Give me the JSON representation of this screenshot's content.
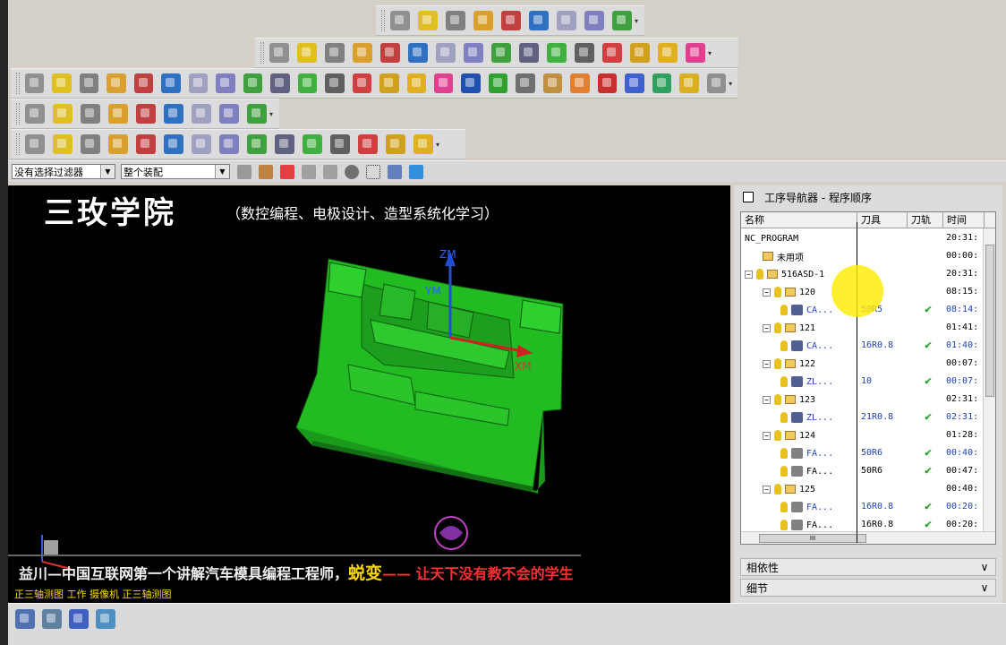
{
  "toolbars": {
    "row1": [
      "align-icon",
      "route-icon",
      "hand-icon",
      "stack-icon",
      "hand-up-icon",
      "grid-icon",
      "tree-icon",
      "list-icon",
      "clock-icon"
    ],
    "row2": [
      "check-icon",
      "ops-icon",
      "program-icon",
      "table-icon",
      "flag-icon",
      "verify-icon",
      "clipboard-icon",
      "doc-icon",
      "sparkle-icon",
      "tool-clock-icon",
      "export-icon",
      "postprocess-icon",
      "shop-doc-icon",
      "batch-icon",
      "output-icon",
      "cube-green-icon"
    ],
    "row3": [
      "box-orange-icon",
      "box-red-icon",
      "box-yellow-icon",
      "wrench-box-icon",
      "truss-icon",
      "plane-icon",
      "swap-x-icon",
      "circle-cube-icon",
      "wire-cube-icon",
      "rainbow-icon",
      "cylinder-icon",
      "tilt-box-icon",
      "ruler-icon",
      "kg-icon",
      "pipe-icon",
      "lego-icon",
      "prt-icon",
      "layers-icon",
      "stack-grey-icon",
      "cubes-icon",
      "star-icon",
      "coins-icon",
      "tube-icon",
      "hex-icon",
      "bar-green-icon",
      "bar-green2-icon"
    ],
    "row4": [
      "dxf-icon",
      "inch-mm-icon",
      "layers-blue-icon",
      "folder-icon",
      "monitor-icon",
      "note-icon",
      "calculator-icon",
      "moon-icon",
      "matrix-icon"
    ],
    "row5": [
      "layer-a-icon",
      "layer-b-icon",
      "layer-c-icon",
      "cross-icon",
      "layer-d-icon",
      "snap-icon",
      "plus-icon",
      "up-arrow-icon",
      "down-arrow-icon",
      "arrow-sheet-icon",
      "sheet-b-icon",
      "sheet-c-icon",
      "sheet-d-icon",
      "sheet-e-icon",
      "sheet-f-icon"
    ]
  },
  "filterbar": {
    "filter_label": "没有选择过滤器",
    "assembly_label": "整个装配"
  },
  "viewport": {
    "title": "三玫学院",
    "subtitle": "（数控编程、电极设计、造型系统化学习）",
    "bottom_text_1": "益川—中国互联网第一个讲解汽车模具编程工程师，",
    "bottom_text_highlight": "蜕变",
    "bottom_text_2": "—— 让天下没有教不会的学生",
    "view_label": "正三轴测图 工作 摄像机 正三轴测图",
    "axis_zm": "ZM",
    "axis_ym": "YM",
    "axis_xm": "XM",
    "part_color": "#22bb22"
  },
  "navigator": {
    "title": "工序导航器 - 程序顺序",
    "columns": [
      "名称",
      "刀具",
      "刀轨",
      "时间"
    ],
    "rows": [
      {
        "indent": 0,
        "expander": "",
        "kind": "text",
        "name": "NC_PROGRAM",
        "tool": "",
        "check": false,
        "time": "20:31:",
        "blue": false
      },
      {
        "indent": 1,
        "expander": "",
        "kind": "folder",
        "name": "未用项",
        "tool": "",
        "check": false,
        "time": "00:00:",
        "blue": false
      },
      {
        "indent": 0,
        "expander": "⊟",
        "kind": "bulbfolder",
        "name": "516ASD-1",
        "tool": "",
        "check": false,
        "time": "20:31:",
        "blue": false
      },
      {
        "indent": 1,
        "expander": "⊟",
        "kind": "bulbfolder",
        "name": "120",
        "tool": "",
        "check": false,
        "time": "08:15:",
        "blue": false
      },
      {
        "indent": 2,
        "expander": "",
        "kind": "op",
        "name": "CA...",
        "tool": "50R5",
        "check": true,
        "time": "08:14:",
        "blue": true
      },
      {
        "indent": 1,
        "expander": "⊟",
        "kind": "bulbfolder",
        "name": "121",
        "tool": "",
        "check": false,
        "time": "01:41:",
        "blue": false
      },
      {
        "indent": 2,
        "expander": "",
        "kind": "op",
        "name": "CA...",
        "tool": "16R0.8",
        "check": true,
        "time": "01:40:",
        "blue": true
      },
      {
        "indent": 1,
        "expander": "⊟",
        "kind": "bulbfolder",
        "name": "122",
        "tool": "",
        "check": false,
        "time": "00:07:",
        "blue": false
      },
      {
        "indent": 2,
        "expander": "",
        "kind": "op",
        "name": "ZL...",
        "tool": "10",
        "check": true,
        "time": "00:07:",
        "blue": true
      },
      {
        "indent": 1,
        "expander": "⊟",
        "kind": "bulbfolder",
        "name": "123",
        "tool": "",
        "check": false,
        "time": "02:31:",
        "blue": false
      },
      {
        "indent": 2,
        "expander": "",
        "kind": "op",
        "name": "ZL...",
        "tool": "21R0.8",
        "check": true,
        "time": "02:31:",
        "blue": true
      },
      {
        "indent": 1,
        "expander": "⊟",
        "kind": "bulbfolder",
        "name": "124",
        "tool": "",
        "check": false,
        "time": "01:28:",
        "blue": false
      },
      {
        "indent": 2,
        "expander": "",
        "kind": "opfa",
        "name": "FA...",
        "tool": "50R6",
        "check": true,
        "time": "00:40:",
        "blue": true
      },
      {
        "indent": 2,
        "expander": "",
        "kind": "opfa",
        "name": "FA...",
        "tool": "50R6",
        "check": true,
        "time": "00:47:",
        "blue": false
      },
      {
        "indent": 1,
        "expander": "⊟",
        "kind": "bulbfolder",
        "name": "125",
        "tool": "",
        "check": false,
        "time": "00:40:",
        "blue": false
      },
      {
        "indent": 2,
        "expander": "",
        "kind": "opfa",
        "name": "FA...",
        "tool": "16R0.8",
        "check": true,
        "time": "00:20:",
        "blue": true
      },
      {
        "indent": 2,
        "expander": "",
        "kind": "opfa",
        "name": "FA...",
        "tool": "16R0.8",
        "check": true,
        "time": "00:20:",
        "blue": false
      }
    ],
    "hscroll_label": "III",
    "dependencies_label": "相依性",
    "details_label": "细节"
  },
  "bottom_toolbar": [
    "view-a-icon",
    "view-b-icon",
    "view-c-icon",
    "view-d-icon"
  ]
}
